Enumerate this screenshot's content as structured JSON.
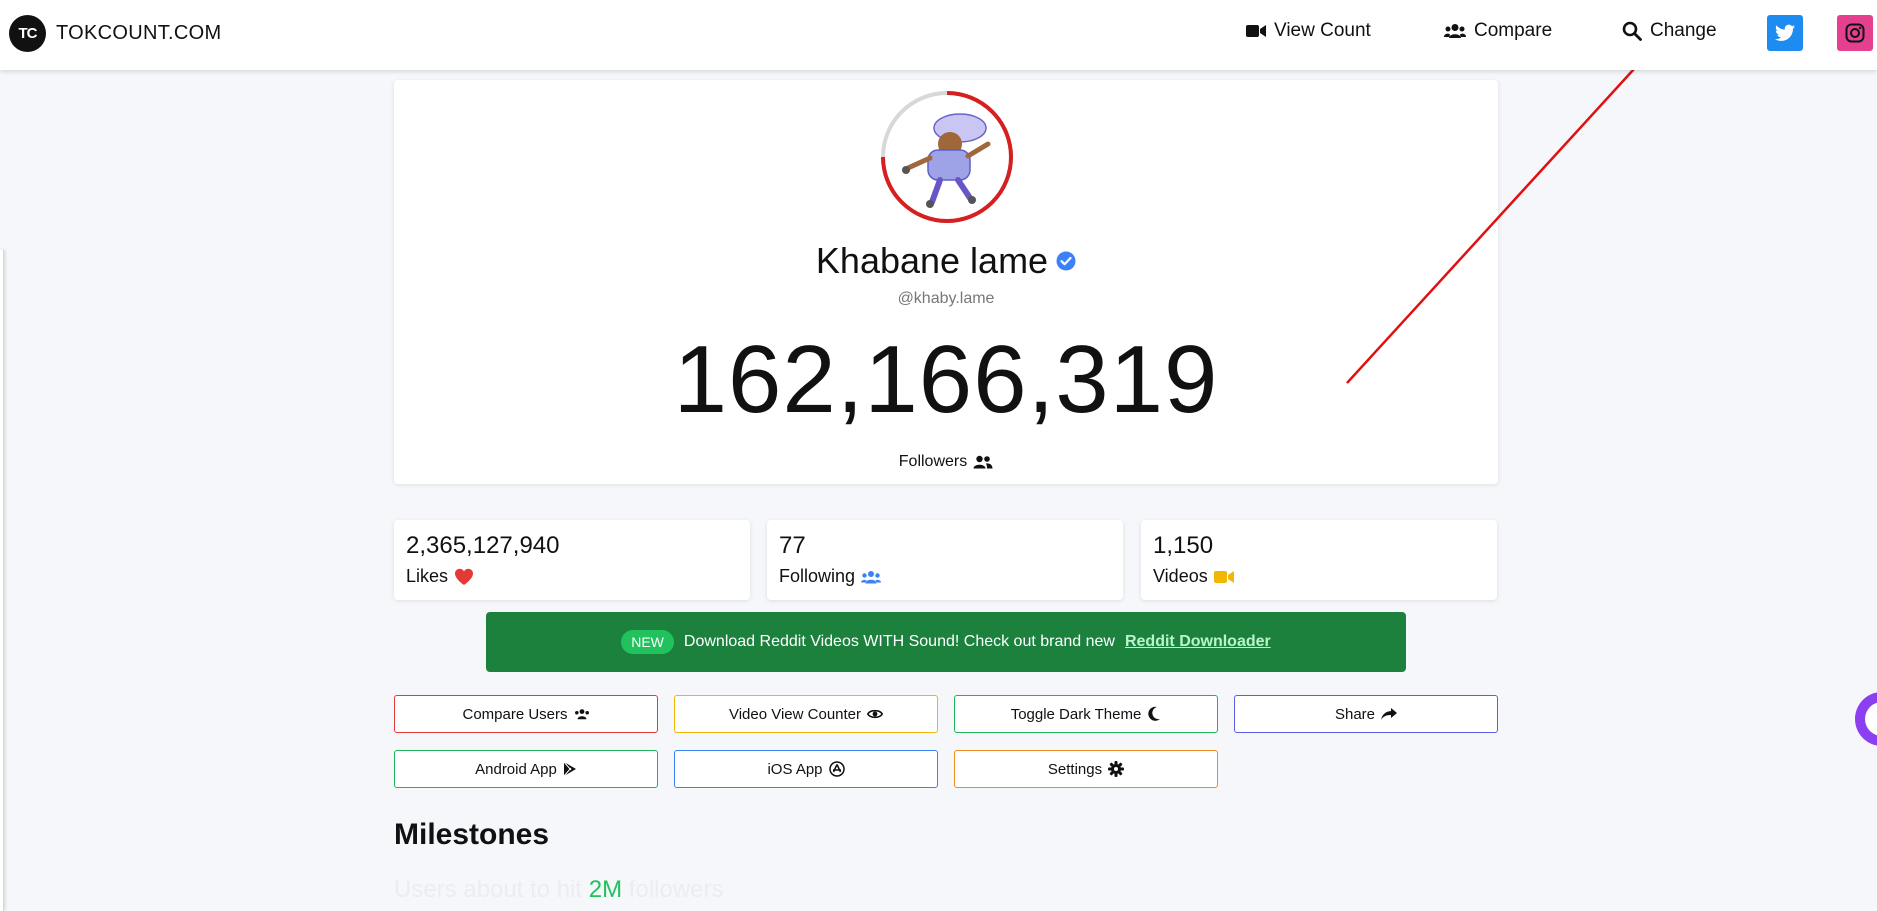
{
  "nav": {
    "brand_logo": "TC",
    "brand_name": "TOKCOUNT.COM",
    "links": [
      {
        "label": "View Count",
        "icon": "video-icon"
      },
      {
        "label": "Compare",
        "icon": "users-icon"
      },
      {
        "label": "Change",
        "icon": "search-icon"
      }
    ],
    "social": [
      {
        "icon": "twitter-icon",
        "color": "#1d8bf0"
      },
      {
        "icon": "instagram-icon",
        "color": "#e4408f"
      }
    ]
  },
  "profile": {
    "display_name": "Khabane lame",
    "username": "@khaby.lame",
    "followers": "162,166,319",
    "followers_label": "Followers",
    "ring_color": "#d61f1f"
  },
  "stats": [
    {
      "value": "2,365,127,940",
      "label": "Likes",
      "icon": "heart-icon",
      "icon_color": "#e53935"
    },
    {
      "value": "77",
      "label": "Following",
      "icon": "users-icon",
      "icon_color": "#3b82f6"
    },
    {
      "value": "1,150",
      "label": "Videos",
      "icon": "video-icon",
      "icon_color": "#f2b705"
    }
  ],
  "banner": {
    "badge": "NEW",
    "text": "Download Reddit Videos WITH Sound! Check out brand new",
    "link": "Reddit Downloader",
    "bg": "#1b813d"
  },
  "actions": [
    {
      "label": "Compare Users",
      "icon": "users-icon",
      "border": "#e53935"
    },
    {
      "label": "Video View Counter",
      "icon": "eye-icon",
      "border": "#f2b705"
    },
    {
      "label": "Toggle Dark Theme",
      "icon": "moon-icon",
      "border": "#21b35a"
    },
    {
      "label": "Share",
      "icon": "share-icon",
      "border": "#5b5fe0"
    },
    {
      "label": "Android App",
      "icon": "play-store-icon",
      "border": "#21b35a"
    },
    {
      "label": "iOS App",
      "icon": "app-store-icon",
      "border": "#3b82f6"
    },
    {
      "label": "Settings",
      "icon": "gear-icon",
      "border": "#f08c1e"
    }
  ],
  "milestones": {
    "title": "Milestones",
    "sub_prefix": "Users about to hit",
    "sub_highlight": "2M",
    "sub_suffix": "followers"
  }
}
